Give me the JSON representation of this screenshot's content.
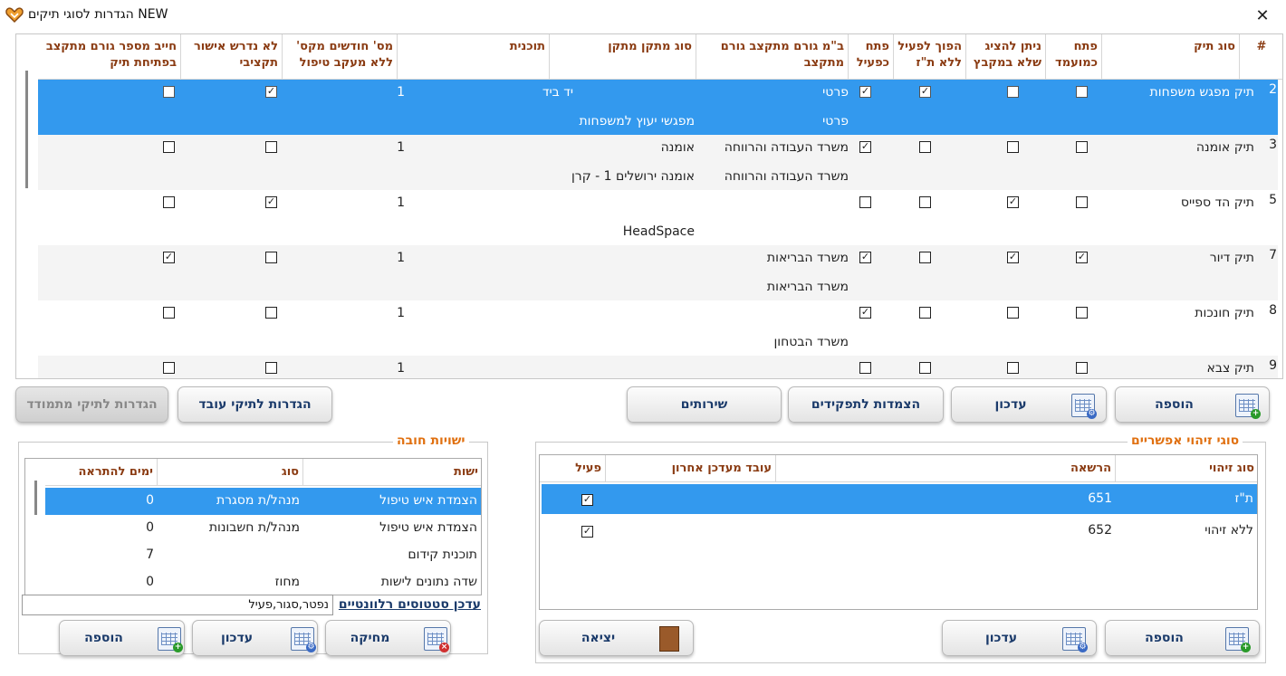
{
  "window": {
    "title": "הגדרות לסוגי תיקים NEW",
    "close_icon": "close-icon",
    "app_icon": "heart-logo-icon"
  },
  "main_grid": {
    "columns": [
      "#",
      "סוג תיק",
      "פתח כמועמד",
      "ניתן להציג שלא במקבץ",
      "הפוך לפעיל ללא ת\"ז",
      "פתח כפעיל",
      "ב\"מ גורם מתקצב גורם מתקצב",
      "סוג מתקן מתקן",
      "תוכנית",
      "מס' חודשים מקס' ללא מעקב טיפול",
      "לא נדרש אישור תקציבי",
      "חייב מספר גורם מתקצב בפתיחת תיק"
    ],
    "rows": [
      {
        "num": "2",
        "type": "תיק מפגש משפחות",
        "candidate": false,
        "no_bundle": false,
        "active_no_id": true,
        "open_active": true,
        "funder_1": "פרטי",
        "funder_2": "פרטי",
        "facility_1": "",
        "facility_2": "מפגשי יעוץ למשפחות",
        "program": "יד ביד",
        "months": "1",
        "no_budget": true,
        "funder_required": false,
        "selected": true
      },
      {
        "num": "3",
        "type": "תיק אומנה",
        "candidate": false,
        "no_bundle": false,
        "active_no_id": false,
        "open_active": true,
        "funder_1": "משרד העבודה והרווחה",
        "funder_2": "משרד העבודה והרווחה",
        "facility_1": "אומנה",
        "facility_2": "אומנה ירושלים 1 - קרן",
        "program": "",
        "months": "1",
        "no_budget": false,
        "funder_required": false,
        "selected": false
      },
      {
        "num": "5",
        "type": "תיק הד ספייס",
        "candidate": false,
        "no_bundle": true,
        "active_no_id": false,
        "open_active": false,
        "funder_1": "",
        "funder_2": "",
        "facility_1": "",
        "facility_2": "HeadSpace",
        "program": "",
        "months": "1",
        "no_budget": true,
        "funder_required": false,
        "selected": false
      },
      {
        "num": "7",
        "type": "תיק דיור",
        "candidate": true,
        "no_bundle": true,
        "active_no_id": false,
        "open_active": true,
        "funder_1": "משרד הבריאות",
        "funder_2": "משרד הבריאות",
        "facility_1": "",
        "facility_2": "",
        "program": "",
        "months": "1",
        "no_budget": false,
        "funder_required": true,
        "selected": false
      },
      {
        "num": "8",
        "type": "תיק חונכות",
        "candidate": false,
        "no_bundle": false,
        "active_no_id": false,
        "open_active": true,
        "funder_1": "",
        "funder_2": "משרד הבטחון",
        "facility_1": "",
        "facility_2": "",
        "program": "",
        "months": "1",
        "no_budget": false,
        "funder_required": false,
        "selected": false
      },
      {
        "num": "9",
        "type": "תיק צבא",
        "candidate": false,
        "no_bundle": false,
        "active_no_id": false,
        "open_active": false,
        "funder_1": "",
        "funder_2": "",
        "facility_1": "",
        "facility_2": "",
        "program": "",
        "months": "1",
        "no_budget": false,
        "funder_required": false,
        "selected": false
      }
    ]
  },
  "main_buttons": {
    "add": "הוספה",
    "update": "עדכון",
    "roles": "הצמדות לתפקידים",
    "services": "שירותים",
    "worker_settings": "הגדרות לתיקי עובד",
    "ongoing_settings": "הגדרות לתיקי מתמודד"
  },
  "id_types": {
    "title": "סוגי זיהוי אפשריים",
    "columns": [
      "סוג זיהוי",
      "הרשאה",
      "עובד מעדכן אחרון",
      "פעיל"
    ],
    "rows": [
      {
        "type": "ת\"ז",
        "permission": "651",
        "updater": "",
        "active": true,
        "selected": true
      },
      {
        "type": "ללא זיהוי",
        "permission": "652",
        "updater": "",
        "active": true,
        "selected": false
      }
    ],
    "add": "הוספה",
    "update": "עדכון",
    "exit": "יציאה"
  },
  "entities": {
    "title": "ישויות חובה",
    "columns": [
      "ישות",
      "סוג",
      "ימים להתראה"
    ],
    "rows": [
      {
        "entity": "הצמדת איש טיפול",
        "type": "מנהל/ת מסגרת",
        "days": "0",
        "selected": true
      },
      {
        "entity": "הצמדת איש טיפול",
        "type": "מנהל/ת חשבונות",
        "days": "0",
        "selected": false
      },
      {
        "entity": "תוכנית קידום",
        "type": "",
        "days": "7",
        "selected": false
      },
      {
        "entity": "שדה נתונים לישות",
        "type": "מחוז",
        "days": "0",
        "selected": false
      }
    ],
    "status_link": "עדכן סטטוסים רלוונטיים",
    "status_value": "נפטר,סגור,פעיל",
    "delete": "מחיקה",
    "update": "עדכון",
    "add": "הוספה"
  }
}
